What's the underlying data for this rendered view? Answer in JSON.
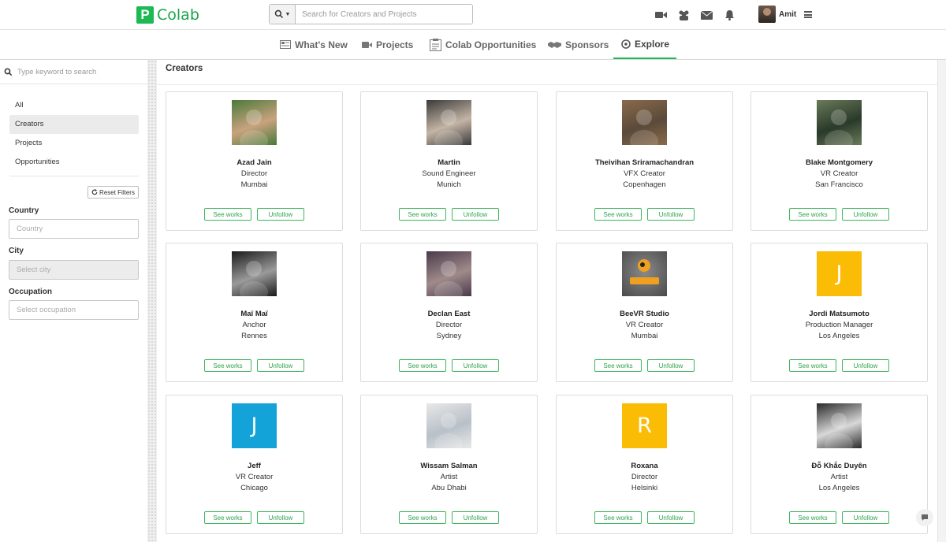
{
  "app": {
    "logo_letter": "P",
    "name": "Colab",
    "brand_color": "#1db954"
  },
  "header": {
    "search_placeholder": "Search for Creators and Projects",
    "icons": [
      "video-camera-icon",
      "users-icon",
      "envelope-icon",
      "bell-icon"
    ],
    "user_name": "Amit"
  },
  "nav": {
    "tabs": [
      {
        "label": "What's New",
        "icon": "newspaper-icon"
      },
      {
        "label": "Projects",
        "icon": "video-camera-icon"
      },
      {
        "label": "Colab Opportunities",
        "icon": "clipboard-icon"
      },
      {
        "label": "Sponsors",
        "icon": "handshake-icon"
      },
      {
        "label": "Explore",
        "icon": "compass-icon",
        "active": true
      }
    ]
  },
  "sidebar": {
    "search_placeholder": "Type keyword to search",
    "items": [
      {
        "label": "All"
      },
      {
        "label": "Creators",
        "selected": true
      },
      {
        "label": "Projects"
      },
      {
        "label": "Opportunities"
      }
    ],
    "reset_label": "Reset Filters",
    "filters": {
      "country_label": "Country",
      "country_placeholder": "Country",
      "city_label": "City",
      "city_placeholder": "Select city",
      "occupation_label": "Occupation",
      "occupation_placeholder": "Select occupation"
    }
  },
  "main": {
    "title": "Creators",
    "see_works_label": "See works",
    "unfollow_label": "Unfollow",
    "creators": [
      {
        "name": "Azad Jain",
        "role": "Director",
        "city": "Mumbai",
        "avatar": "photo",
        "colors": [
          "#4a7a3a",
          "#c9a27e"
        ]
      },
      {
        "name": "Martin",
        "role": "Sound Engineer",
        "city": "Munich",
        "avatar": "photo",
        "colors": [
          "#3a3a3a",
          "#c4b5a5"
        ]
      },
      {
        "name": "Theivihan Sriramachandran",
        "role": "VFX Creator",
        "city": "Copenhagen",
        "avatar": "photo",
        "colors": [
          "#8a6a4a",
          "#5a4a3a"
        ]
      },
      {
        "name": "Blake Montgomery",
        "role": "VR Creator",
        "city": "San Francisco",
        "avatar": "photo",
        "colors": [
          "#6a7a5a",
          "#2a3a2a"
        ]
      },
      {
        "name": "Maï Maï",
        "role": "Anchor",
        "city": "Rennes",
        "avatar": "photo",
        "colors": [
          "#1a1a1a",
          "#9a9a9a"
        ]
      },
      {
        "name": "Declan East",
        "role": "Director",
        "city": "Sydney",
        "avatar": "photo",
        "colors": [
          "#4a3a4a",
          "#a08a8a"
        ]
      },
      {
        "name": "BeeVR Studio",
        "role": "VR Creator",
        "city": "Mumbai",
        "avatar": "logo",
        "colors": [
          "#4a4a4a",
          "#f0a020"
        ]
      },
      {
        "name": "Jordi Matsumoto",
        "role": "Production Manager",
        "city": "Los Angeles",
        "avatar": "letter",
        "letter": "J",
        "colors": [
          "#fbbc05"
        ]
      },
      {
        "name": "Jeff",
        "role": "VR Creator",
        "city": "Chicago",
        "avatar": "letter",
        "letter": "J",
        "colors": [
          "#14a3d8"
        ]
      },
      {
        "name": "Wissam Salman",
        "role": "Artist",
        "city": "Abu Dhabi",
        "avatar": "photo",
        "colors": [
          "#e8e8e8",
          "#b8c0c8"
        ]
      },
      {
        "name": "Roxana",
        "role": "Director",
        "city": "Helsinki",
        "avatar": "letter",
        "letter": "R",
        "colors": [
          "#fbbc05"
        ]
      },
      {
        "name": "Đỗ Khắc Duyên",
        "role": "Artist",
        "city": "Los Angeles",
        "avatar": "photo",
        "colors": [
          "#2a2a2a",
          "#d8d8d8"
        ]
      }
    ]
  }
}
